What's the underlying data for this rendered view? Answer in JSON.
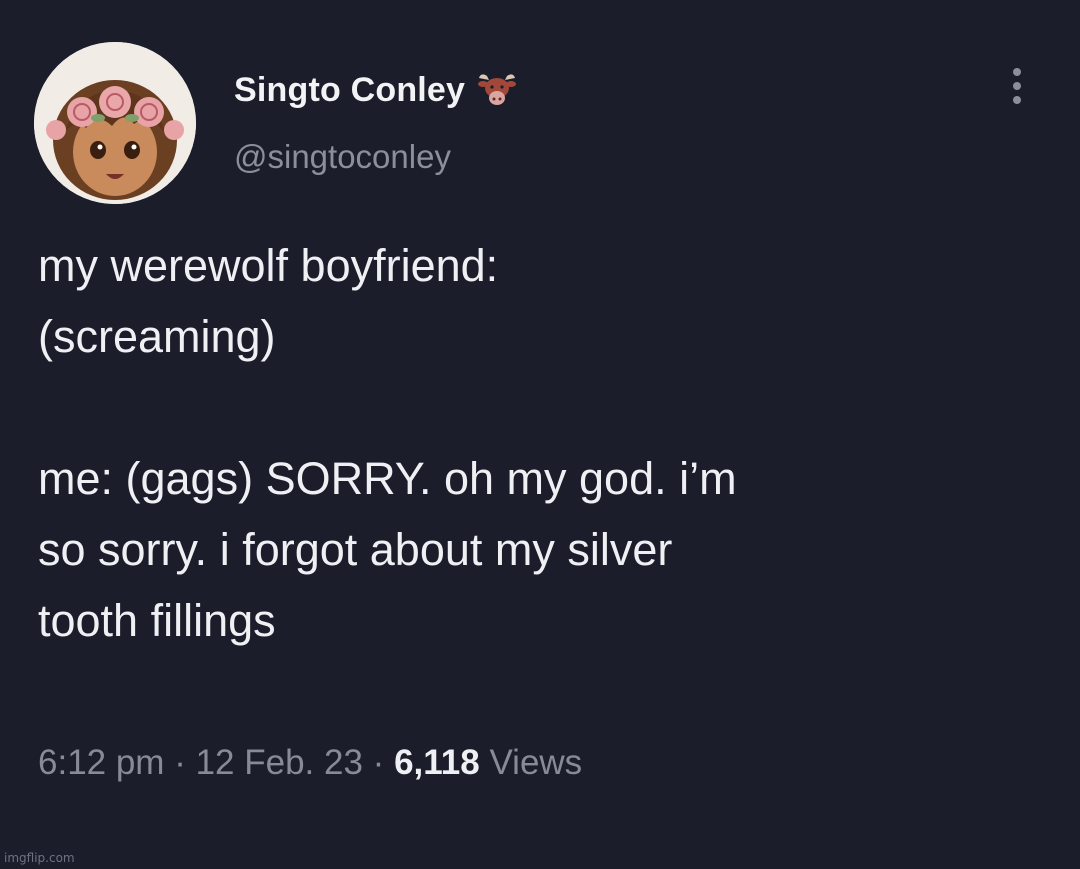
{
  "user": {
    "display_name": "Singto Conley",
    "handle": "@singtoconley",
    "emoji_icon": "bull-head-icon"
  },
  "tweet": {
    "lines": [
      "my werewolf boyfriend:",
      "(screaming)",
      "",
      "me: (gags) SORRY. oh my god. i’m",
      "so sorry. i forgot about my silver",
      "tooth fillings"
    ]
  },
  "meta": {
    "time": "6:12 pm",
    "separator": "·",
    "date": "12 Feb. 23",
    "views_count": "6,118",
    "views_label": "Views"
  },
  "watermark": "imgflip.com",
  "colors": {
    "background": "#1b1d2b",
    "text": "#eef0f3",
    "secondary": "#868b96"
  }
}
